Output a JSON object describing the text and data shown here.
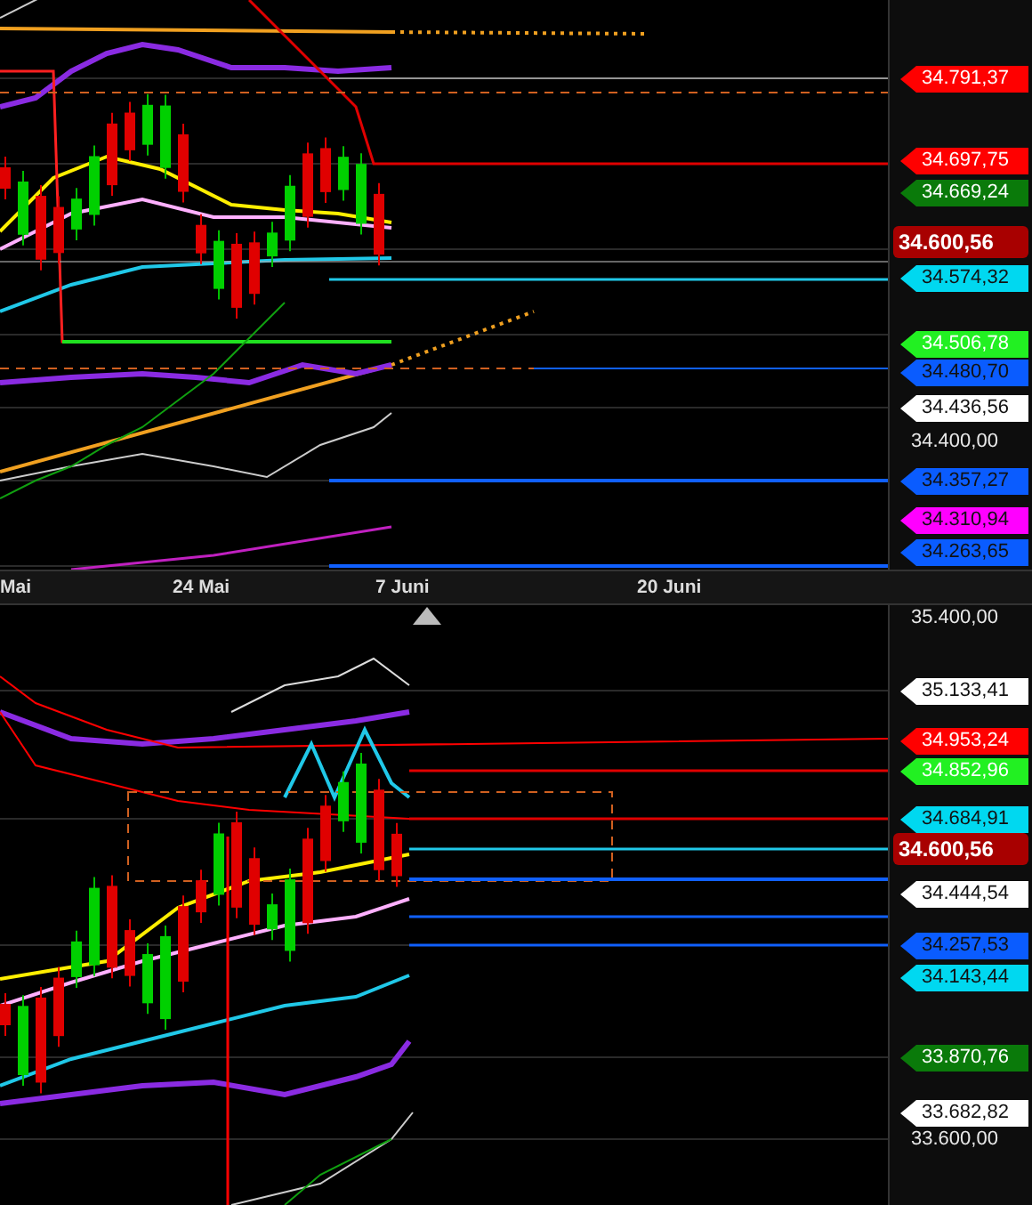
{
  "top_panel": {
    "price_labels": [
      {
        "text": "34.791,37",
        "kind": "tag",
        "color": "#ff0000"
      },
      {
        "text": "34.697,75",
        "kind": "tag",
        "color": "#ff0000"
      },
      {
        "text": "34.669,24",
        "kind": "tag",
        "color": "#0a7a0a"
      },
      {
        "text": "34.600,56",
        "kind": "current",
        "color": "#a80000"
      },
      {
        "text": "34.574,32",
        "kind": "tag",
        "color": "#00d8f0"
      },
      {
        "text": "34.506,78",
        "kind": "tag",
        "color": "#22f022"
      },
      {
        "text": "34.480,70",
        "kind": "tag",
        "color": "#0a5cff"
      },
      {
        "text": "34.436,56",
        "kind": "tag",
        "color": "#ffffff"
      },
      {
        "text": "34.400,00",
        "kind": "plain"
      },
      {
        "text": "34.357,27",
        "kind": "tag",
        "color": "#0a5cff"
      },
      {
        "text": "34.310,94",
        "kind": "tag",
        "color": "#ff00ff"
      },
      {
        "text": "34.263,65",
        "kind": "tag",
        "color": "#0a5cff"
      }
    ]
  },
  "time_axis": {
    "dates": [
      "Mai",
      "24 Mai",
      "7 Juni",
      "20 Juni"
    ]
  },
  "bottom_panel": {
    "price_labels": [
      {
        "text": "35.400,00",
        "kind": "plain"
      },
      {
        "text": "35.133,41",
        "kind": "tag",
        "color": "#ffffff"
      },
      {
        "text": "34.953,24",
        "kind": "tag",
        "color": "#ff0000"
      },
      {
        "text": "34.852,96",
        "kind": "tag",
        "color": "#22f022"
      },
      {
        "text": "34.684,91",
        "kind": "tag",
        "color": "#00d8f0"
      },
      {
        "text": "34.600,56",
        "kind": "current",
        "color": "#a80000"
      },
      {
        "text": "34.444,54",
        "kind": "tag",
        "color": "#ffffff"
      },
      {
        "text": "34.257,53",
        "kind": "tag",
        "color": "#0a5cff"
      },
      {
        "text": "34.143,44",
        "kind": "tag",
        "color": "#00d8f0"
      },
      {
        "text": "33.870,76",
        "kind": "tag",
        "color": "#0a7a0a"
      },
      {
        "text": "33.682,82",
        "kind": "tag",
        "color": "#ffffff"
      },
      {
        "text": "33.600,00",
        "kind": "plain"
      }
    ]
  }
}
